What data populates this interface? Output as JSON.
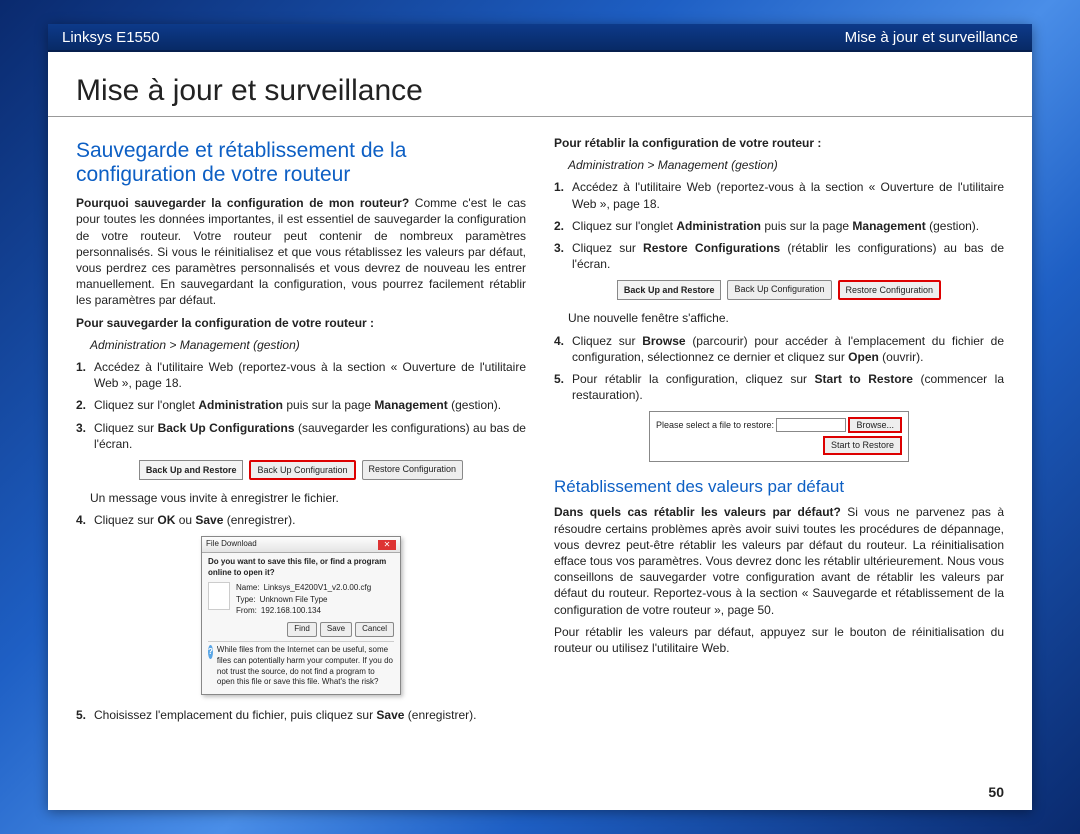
{
  "header": {
    "left": "Linksys E1550",
    "right": "Mise à jour et surveillance"
  },
  "chapter_title": "Mise à jour et surveillance",
  "page_number": "50",
  "left": {
    "h2": "Sauvegarde et rétablissement de la configuration de votre routeur",
    "intro_bold": "Pourquoi sauvegarder la configuration de mon routeur?",
    "intro_rest": " Comme c'est le cas pour toutes les données importantes, il est essentiel de sauvegarder la configuration de votre routeur. Votre routeur peut contenir de nombreux paramètres personnalisés. Si vous le réinitialisez et que vous rétablissez les valeurs par défaut, vous perdrez ces paramètres personnalisés et vous devrez de nouveau les entrer manuellement. En sauvegardant la configuration, vous pourrez facilement rétablir les paramètres par défaut.",
    "subhead": "Pour sauvegarder la configuration de votre routeur :",
    "navpath": "Administration > Management (gestion)",
    "steps": [
      "Accédez à l'utilitaire Web (reportez-vous à la section « Ouverture de l'utilitaire Web », page 18.",
      "Cliquez sur l'onglet <b>Administration</b> puis sur la page <b>Management</b> (gestion).",
      "Cliquez sur <b>Back Up Configurations</b> (sauvegarder les configurations) au bas de l'écran."
    ],
    "btnbar": {
      "label": "Back Up and Restore",
      "b1": "Back Up Configuration",
      "b2": "Restore Configuration",
      "highlight": "b1"
    },
    "msg_after_bar": "Un message vous invite à enregistrer le fichier.",
    "step4": "Cliquez sur <b>OK</b> ou <b>Save</b> (enregistrer).",
    "dialog": {
      "title": "File Download",
      "q": "Do you want to save this file, or find a program online to open it?",
      "name_lbl": "Name:",
      "name_val": "Linksys_E4200V1_v2.0.00.cfg",
      "type_lbl": "Type:",
      "type_val": "Unknown File Type",
      "from_lbl": "From:",
      "from_val": "192.168.100.134",
      "find": "Find",
      "save": "Save",
      "cancel": "Cancel",
      "warn": "While files from the Internet can be useful, some files can potentially harm your computer. If you do not trust the source, do not find a program to open this file or save this file. What's the risk?"
    },
    "step5": "Choisissez l'emplacement du fichier, puis cliquez sur <b>Save</b> (enregistrer)."
  },
  "right": {
    "subhead": "Pour rétablir la configuration de votre routeur :",
    "navpath": "Administration > Management (gestion)",
    "steps": [
      "Accédez à l'utilitaire Web (reportez-vous à la section « Ouverture de l'utilitaire Web », page 18.",
      "Cliquez sur l'onglet <b>Administration</b> puis sur la page <b>Management</b> (gestion).",
      "Cliquez sur <b>Restore Configurations</b> (rétablir les configurations) au bas de l'écran."
    ],
    "btnbar": {
      "label": "Back Up and Restore",
      "b1": "Back Up Configuration",
      "b2": "Restore Configuration",
      "highlight": "b2"
    },
    "new_window_msg": "Une nouvelle fenêtre s'affiche.",
    "step4": "Cliquez sur <b>Browse</b> (parcourir) pour accéder à l'emplacement du fichier de configuration, sélectionnez ce dernier et cliquez sur <b>Open</b> (ouvrir).",
    "step5": "Pour rétablir la configuration, cliquez sur <b>Start to Restore</b> (commencer la restauration).",
    "restorebox": {
      "prompt": "Please select a file to restore:",
      "browse": "Browse...",
      "start": "Start to Restore"
    },
    "h3": "Rétablissement des valeurs par défaut",
    "defaults_bold": "Dans quels cas rétablir les valeurs par défaut?",
    "defaults_rest": " Si vous ne parvenez pas à résoudre certains problèmes après avoir suivi toutes les procédures de dépannage, vous devrez peut-être rétablir les valeurs par défaut du routeur. La réinitialisation efface tous vos paramètres. Vous devrez donc les rétablir ultérieurement. Nous vous conseillons de sauvegarder votre configuration avant de rétablir les valeurs par défaut du routeur. Reportez-vous à la section « Sauvegarde et rétablissement de la configuration de votre routeur », page 50.",
    "defaults_tail": "Pour rétablir les valeurs par défaut, appuyez sur le bouton de réinitialisation du routeur ou utilisez l'utilitaire Web."
  }
}
